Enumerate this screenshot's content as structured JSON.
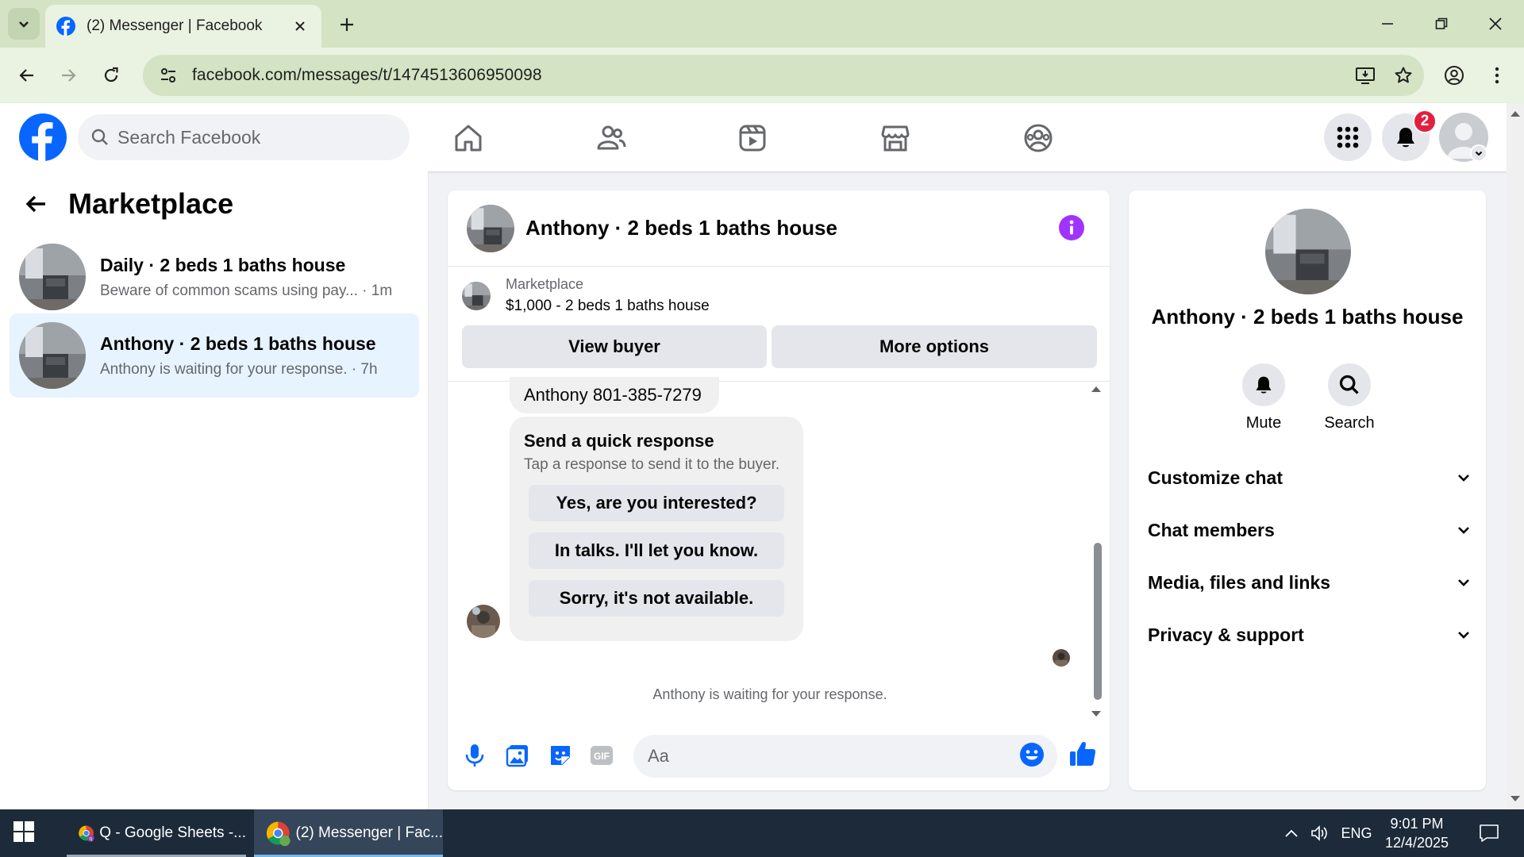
{
  "browser": {
    "tab_title": "(2) Messenger | Facebook",
    "url": "facebook.com/messages/t/1474513606950098"
  },
  "header": {
    "search_placeholder": "Search Facebook",
    "notification_count": "2"
  },
  "left": {
    "title": "Marketplace",
    "conversations": [
      {
        "name": "Daily · 2 beds 1 baths house",
        "snippet": "Beware of common scams using pay... · 1m"
      },
      {
        "name": "Anthony · 2 beds 1 baths house",
        "snippet": "Anthony is waiting for your response. · 7h"
      }
    ]
  },
  "chat": {
    "title": "Anthony · 2 beds 1 baths house",
    "marketplace_label": "Marketplace",
    "listing": "$1,000 - 2 beds 1 baths house",
    "view_buyer": "View buyer",
    "more_options": "More options",
    "phone_message": "Anthony 801-385-7279",
    "quick_title": "Send a quick response",
    "quick_sub": "Tap a response to send it to the buyer.",
    "quick_replies": [
      "Yes, are you interested?",
      "In talks. I'll let you know.",
      "Sorry, it's not available."
    ],
    "waiting": "Anthony is waiting for your response.",
    "composer_placeholder": "Aa"
  },
  "info": {
    "name": "Anthony · 2 beds 1 baths house",
    "mute": "Mute",
    "search": "Search",
    "rows": [
      "Customize chat",
      "Chat members",
      "Media, files and links",
      "Privacy & support"
    ]
  },
  "taskbar": {
    "item1": "Q - Google Sheets -...",
    "item2": "(2) Messenger | Fac...",
    "language": "ENG",
    "time": "9:01 PM",
    "date": "12/4/2025"
  },
  "colors": {
    "fb_blue": "#0866ff",
    "messenger_purple": "#a033ff",
    "badge_red": "#e41e3f"
  }
}
